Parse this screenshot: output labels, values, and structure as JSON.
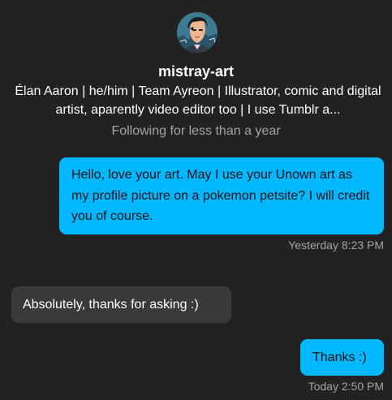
{
  "profile": {
    "username": "mistray-art",
    "bio": "Élan Aaron | he/him | Team Ayreon | Illustrator, comic and digital artist, aparently video editor too | I use Tumblr a...",
    "following_status": "Following for less than a year",
    "avatar_icon": "user-avatar-illustration"
  },
  "messages": [
    {
      "direction": "sent",
      "text": "Hello, love your art. May I use your Unown art as my profile picture on a pokemon petsite? I will credit you of course.",
      "timestamp": "Yesterday 8:23 PM"
    },
    {
      "direction": "received",
      "text": "Absolutely, thanks for asking :)"
    },
    {
      "direction": "sent",
      "text": "Thanks :)",
      "timestamp": "Today 2:50 PM"
    }
  ],
  "colors": {
    "background": "#222222",
    "sent_bubble": "#00b8ff",
    "received_bubble": "#3a3a3a",
    "muted_text": "#a4a4a4"
  }
}
